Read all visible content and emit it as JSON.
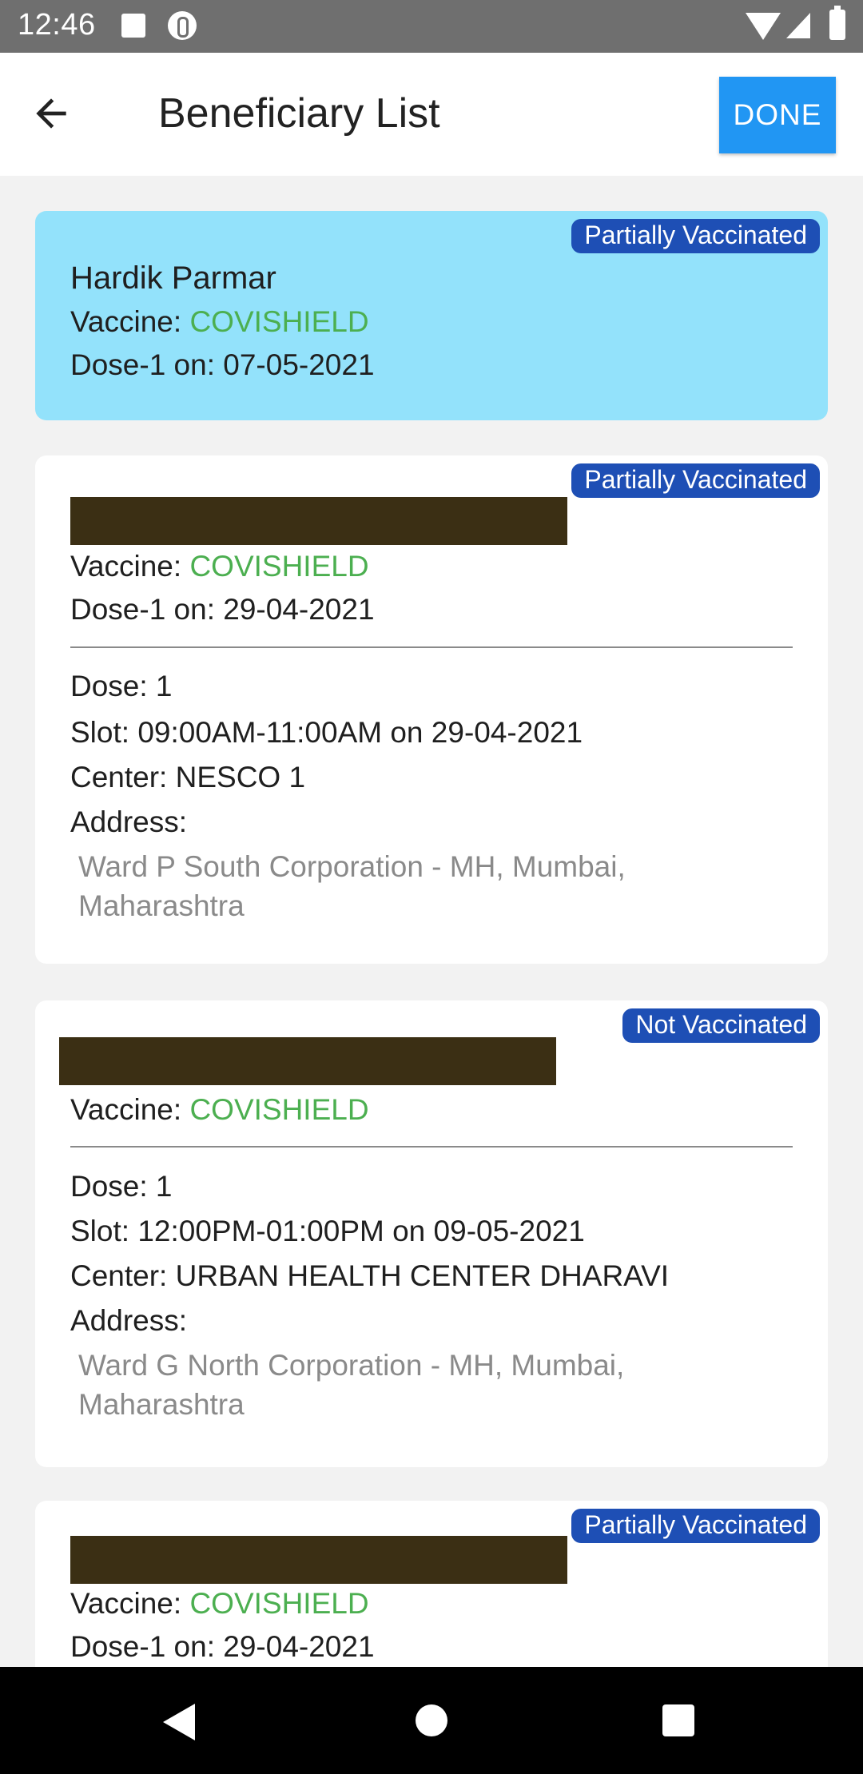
{
  "status_bar": {
    "time": "12:46"
  },
  "app_bar": {
    "title": "Beneficiary List",
    "done_label": "DONE"
  },
  "beneficiaries": [
    {
      "status": "Partially Vaccinated",
      "name": "Hardik Parmar",
      "vaccine_label": "Vaccine:",
      "vaccine": "COVISHIELD",
      "dose_line": "Dose-1 on: 07-05-2021"
    },
    {
      "status": "Partially Vaccinated",
      "vaccine_label": "Vaccine:",
      "vaccine": "COVISHIELD",
      "dose_line": "Dose-1 on: 29-04-2021",
      "appointment": {
        "dose": "Dose: 1",
        "slot": "Slot: 09:00AM-11:00AM on 29-04-2021",
        "center": "Center: NESCO 1",
        "address_label": "Address:",
        "address": "Ward P South Corporation - MH, Mumbai, Maharashtra"
      }
    },
    {
      "status": "Not Vaccinated",
      "vaccine_label": "Vaccine:",
      "vaccine": "COVISHIELD",
      "appointment": {
        "dose": "Dose: 1",
        "slot": "Slot: 12:00PM-01:00PM on 09-05-2021",
        "center": "Center: URBAN HEALTH CENTER DHARAVI",
        "address_label": "Address:",
        "address": "Ward G North Corporation - MH, Mumbai, Maharashtra"
      }
    },
    {
      "status": "Partially Vaccinated",
      "vaccine_label": "Vaccine:",
      "vaccine": "COVISHIELD",
      "dose_line": "Dose-1 on: 29-04-2021"
    }
  ],
  "colors": {
    "accent": "#2196f3",
    "selected_card": "#93e2fb",
    "badge": "#1e4fb5",
    "vaccine_text": "#4caf50"
  }
}
